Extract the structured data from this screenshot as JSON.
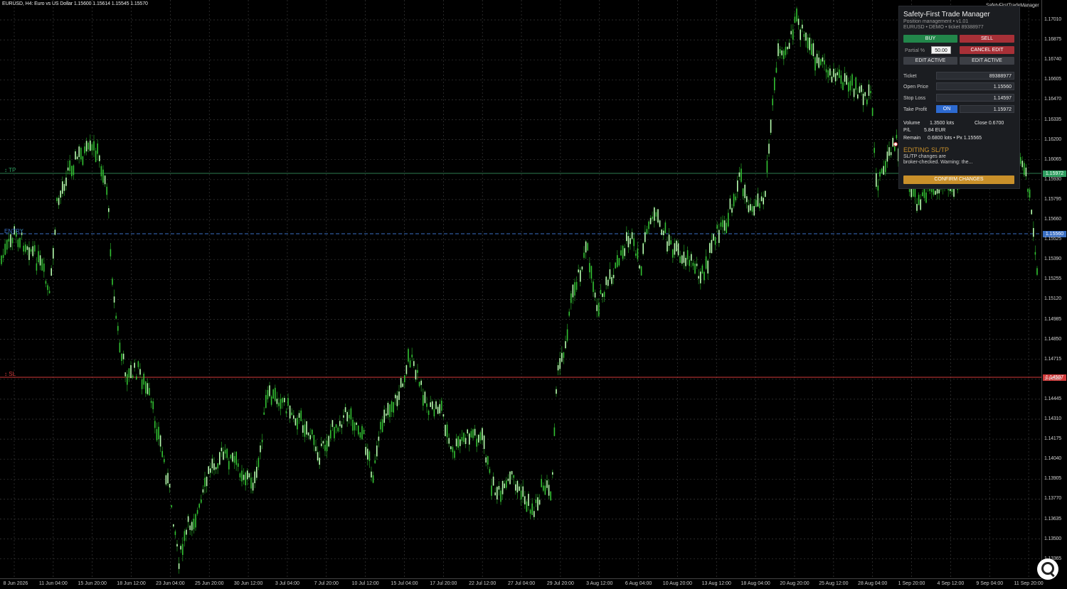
{
  "header": {
    "symbol_info": "EURUSD, H4:  Euro vs US Dollar  1.15600 1.15614 1.15545 1.15570",
    "mini_logo": "SafetyFirstTradeManager"
  },
  "price_axis": {
    "ticks": [
      "1.17010",
      "1.16875",
      "1.16740",
      "1.16605",
      "1.16470",
      "1.16335",
      "1.16200",
      "1.16065",
      "1.15930",
      "1.15795",
      "1.15660",
      "1.15525",
      "1.15390",
      "1.15255",
      "1.15120",
      "1.14985",
      "1.14850",
      "1.14715",
      "1.14580",
      "1.14445",
      "1.14310",
      "1.14175",
      "1.14040",
      "1.13905",
      "1.13770",
      "1.13635",
      "1.13500",
      "1.13365"
    ],
    "tp_tag": "1.15972",
    "entry_tag": "1.15560",
    "sl_tag": "1.14597"
  },
  "time_axis": {
    "ticks": [
      "8 Jun 2026",
      "11 Jun 04:00",
      "15 Jun 20:00",
      "18 Jun 12:00",
      "23 Jun 04:00",
      "25 Jun 20:00",
      "30 Jun 12:00",
      "3 Jul 04:00",
      "7 Jul 20:00",
      "10 Jul 12:00",
      "15 Jul 04:00",
      "17 Jul 20:00",
      "22 Jul 12:00",
      "27 Jul 04:00",
      "29 Jul 20:00",
      "3 Aug 12:00",
      "6 Aug 04:00",
      "10 Aug 20:00",
      "13 Aug 12:00",
      "18 Aug 04:00",
      "20 Aug 20:00",
      "25 Aug 12:00",
      "28 Aug 04:00",
      "1 Sep 20:00",
      "4 Sep 12:00",
      "9 Sep 04:00",
      "11 Sep 20:00"
    ]
  },
  "chart_lines": {
    "tp_label": "TP",
    "entry_label": "ENTRY",
    "sl_label": "SL"
  },
  "panel": {
    "title": "Safety-First Trade Manager",
    "subtitle": "Position management  •  v1.01",
    "account_line": "EURUSD  •  DEMO  •  ticket 89388977",
    "buy_label": "BUY",
    "sell_label": "SELL",
    "partial_label": "Partial %",
    "partial_value": "50.00",
    "cancel_edit_label": "CANCEL EDIT",
    "edit_active_left": "EDIT ACTIVE",
    "edit_active_right": "EDIT ACTIVE",
    "ticket_label": "Ticket",
    "ticket_value": "89388977",
    "open_price_label": "Open Price",
    "open_price_value": "1.15560",
    "stop_loss_label": "Stop Loss",
    "stop_loss_value": "1.14597",
    "take_profit_label": "Take Profit",
    "take_profit_toggle": "ON",
    "take_profit_value": "1.15972",
    "volume_label": "Volume",
    "volume_value": "1.3500 lots",
    "close_text": "Close 0.6700",
    "pl_label": "P/L",
    "pl_value": "5.84 EUR",
    "remain_label": "Remain",
    "remain_value": "0.6800 lots  •  Px 1.15565",
    "warning_title": "EDITING SL/TP",
    "warning_line1": "SL/TP changes are",
    "warning_line2": "broker-checked. Warning: the...",
    "confirm_label": "CONFIRM CHANGES"
  },
  "colors": {
    "tp_line": "#2e7d4f",
    "entry_line": "#3a6fc4",
    "sl_line": "#d23a3a",
    "candle": "#33c233",
    "grid": "#3a3a3a"
  }
}
